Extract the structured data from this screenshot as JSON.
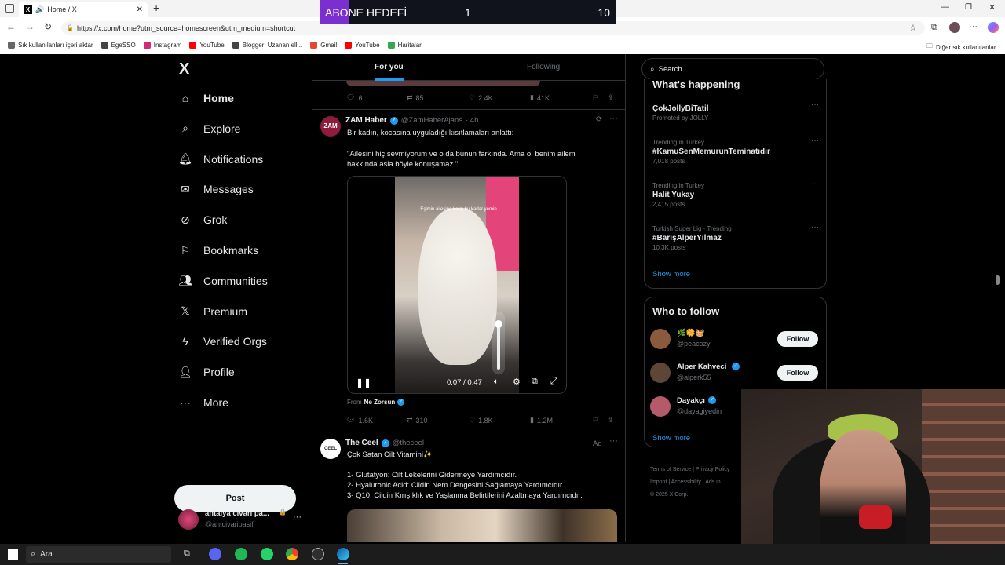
{
  "browser": {
    "tab_title": "Home / X",
    "url": "https://x.com/home?utm_source=homescreen&utm_medium=shortcut",
    "bookmarks": [
      {
        "label": "Sık kullanılanları içeri aktar",
        "icon": "import-icon",
        "color": "#666666"
      },
      {
        "label": "EgeSSO",
        "icon": "globe-icon",
        "color": "#444444"
      },
      {
        "label": "Instagram",
        "icon": "instagram-icon",
        "color": "#d62976"
      },
      {
        "label": "YouTube",
        "icon": "youtube-icon",
        "color": "#ff0000"
      },
      {
        "label": "Blogger: Uzanan ell...",
        "icon": "globe-icon",
        "color": "#444444"
      },
      {
        "label": "Gmail",
        "icon": "gmail-icon",
        "color": "#ea4335"
      },
      {
        "label": "YouTube",
        "icon": "youtube-icon",
        "color": "#ff0000"
      },
      {
        "label": "Haritalar",
        "icon": "maps-icon",
        "color": "#34a853"
      }
    ],
    "other_bookmarks": "Diğer sık kullanılanlar"
  },
  "overlay": {
    "label": "ABONE HEDEFİ",
    "current": "1",
    "target": "10"
  },
  "nav": {
    "logo": "X",
    "items": [
      {
        "label": "Home",
        "icon": "home-icon",
        "active": true
      },
      {
        "label": "Explore",
        "icon": "search-icon"
      },
      {
        "label": "Notifications",
        "icon": "bell-icon"
      },
      {
        "label": "Messages",
        "icon": "mail-icon"
      },
      {
        "label": "Grok",
        "icon": "grok-icon"
      },
      {
        "label": "Bookmarks",
        "icon": "bookmark-icon"
      },
      {
        "label": "Communities",
        "icon": "communities-icon"
      },
      {
        "label": "Premium",
        "icon": "x-icon"
      },
      {
        "label": "Verified Orgs",
        "icon": "lightning-icon"
      },
      {
        "label": "Profile",
        "icon": "person-icon"
      },
      {
        "label": "More",
        "icon": "more-circle-icon"
      }
    ],
    "post_label": "Post",
    "account": {
      "name": "antalya civarı pa...",
      "handle": "@antcivaripasif"
    }
  },
  "feed": {
    "tabs": [
      {
        "label": "For you",
        "active": true
      },
      {
        "label": "Following"
      }
    ],
    "prev_actions": {
      "replies": "6",
      "reposts": "85",
      "likes": "2.4K",
      "views": "41K"
    },
    "tweet1": {
      "avatar_text": "ZAM",
      "name": "ZAM Haber",
      "handle": "@ZamHaberAjans",
      "time": "· 4h",
      "text1": "Bir kadın, kocasına uyguladığı kısıtlamaları anlattı:",
      "text2": "\"Ailesini hiç sevmiyorum ve o da bunun farkında. Ama o, benim ailem hakkında asla böyle konuşamaz.\"",
      "video_time": "0:07 / 0:47",
      "video_caption": "Eşimin ailesine karşı bu kadar yemin",
      "volume_level": 0.85,
      "from_label": "From",
      "from_source": "Ne Zorsun",
      "actions": {
        "replies": "1.6K",
        "reposts": "310",
        "likes": "1.8K",
        "views": "1.2M"
      }
    },
    "tweet2": {
      "avatar_text": "CEEL",
      "name": "The Ceel",
      "handle": "@theceel",
      "ad_label": "Ad",
      "text_title": "Çok Satan Cilt Vitamini✨",
      "lines": [
        "1- Glutatyon: Cilt Lekelerini Gidermeye Yardımcıdır.",
        "2- Hyaluronic Acid: Cildin Nem Dengesini Sağlamaya Yardımcıdır.",
        "3- Q10: Cildin Kırışıklık ve Yaşlanma Belirtilerini Azaltmaya Yardımcıdır."
      ]
    }
  },
  "sidebar": {
    "search_placeholder": "Search",
    "whats_happening": "What's happening",
    "trends": [
      {
        "meta": "",
        "name": "ÇokJollyBiTatil",
        "posts": "Promoted by JOLLY"
      },
      {
        "meta": "Trending in Turkey",
        "name": "#KamuSenMemurunTeminatıdır",
        "posts": "7,018 posts"
      },
      {
        "meta": "Trending in Turkey",
        "name": "Halit Yukay",
        "posts": "2,415 posts"
      },
      {
        "meta": "Turkish Super Lig · Trending",
        "name": "#BarışAlperYılmaz",
        "posts": "10.3K posts"
      }
    ],
    "show_more": "Show more",
    "who_to_follow": "Who to follow",
    "follows": [
      {
        "name": "🌿🌼🧺",
        "handle": "@peacozy",
        "button": "Follow"
      },
      {
        "name": "Alper Kahveci",
        "handle": "@alperk55",
        "button": "Follow"
      },
      {
        "name": "Dayakçı",
        "handle": "@dayagiyedin",
        "button": ""
      }
    ],
    "show_more_2": "Show more",
    "footer": [
      "Terms of Service",
      "Privacy Policy",
      "Imprint",
      "Accessibility",
      "Ads in",
      "© 2025 X Corp."
    ]
  },
  "taskbar": {
    "search": "Ara"
  }
}
